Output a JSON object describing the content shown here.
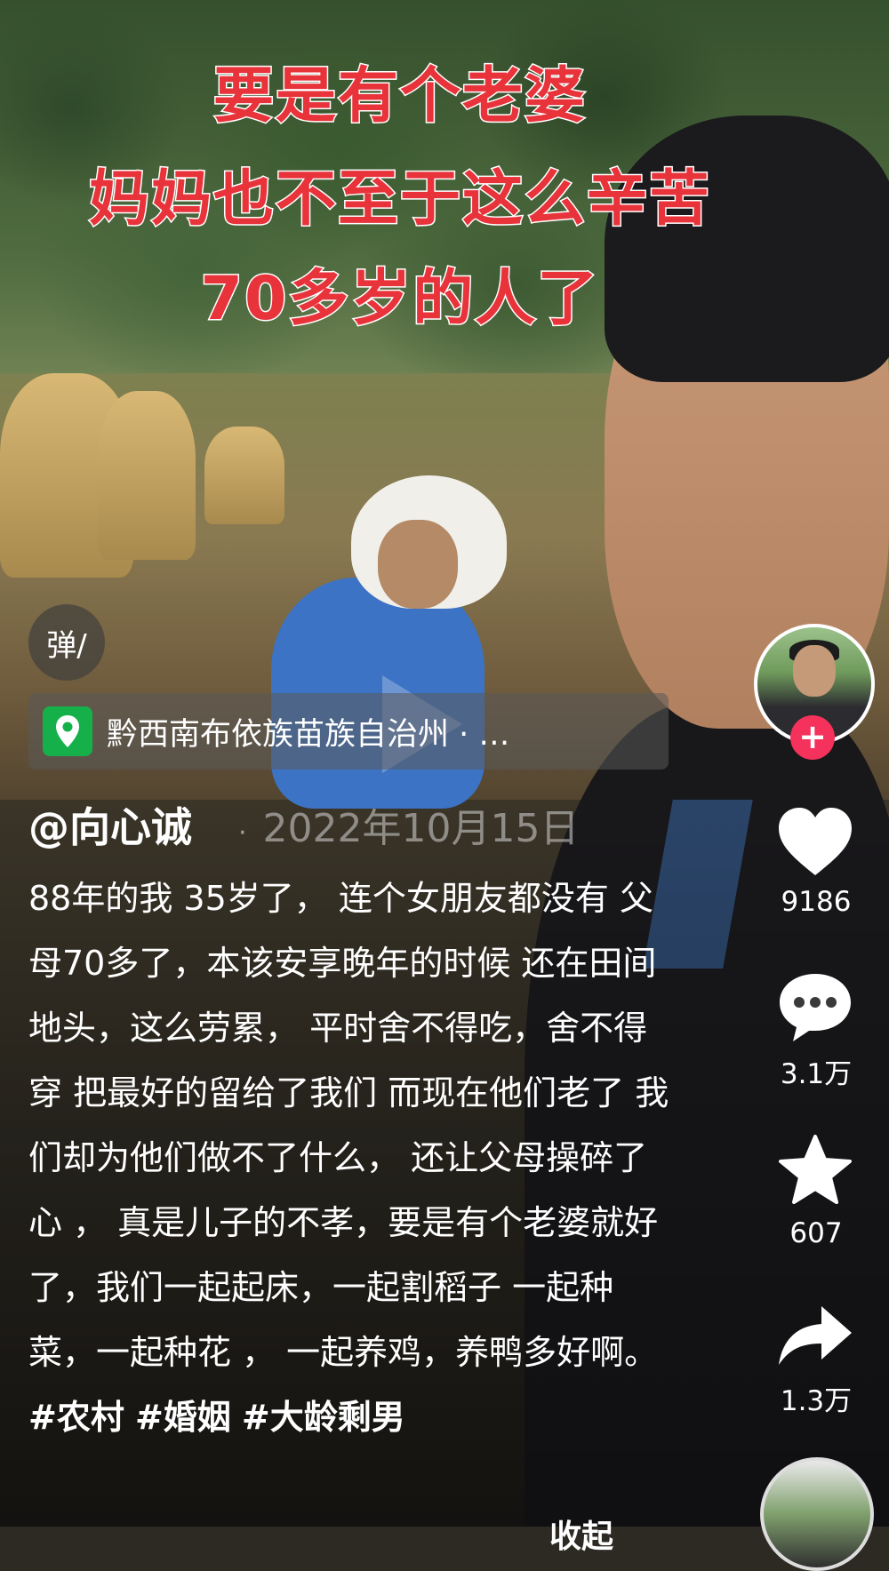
{
  "overlay_caption": {
    "line1": "要是有个老婆",
    "line2": "妈妈也不至于这么辛苦",
    "line3": "70多岁的人了"
  },
  "danmu_button": {
    "label": "弹/",
    "icon": "danmaku-icon"
  },
  "location": {
    "icon": "location-pin-icon",
    "text": "黔西南布依族苗族自治州 · …"
  },
  "author": {
    "handle": "@向心诚",
    "separator": "·",
    "date": "2022年10月15日"
  },
  "description": {
    "text": "88年的我 35岁了， 连个女朋友都没有 父母70多了，本该安享晚年的时候 还在田间地头，这么劳累， 平时舍不得吃，舍不得穿 把最好的留给了我们 而现在他们老了 我们却为他们做不了什么， 还让父母操碎了心 ， 真是儿子的不孝，要是有个老婆就好了，我们一起起床，一起割稻子 一起种菜，一起种花 ， 一起养鸡，养鸭多好啊。",
    "tags": [
      "#农村",
      "#婚姻",
      "#大龄剩男"
    ],
    "collapse_label": "收起"
  },
  "sidebar": {
    "follow_label": "+",
    "like": {
      "icon": "heart-icon",
      "count": "9186"
    },
    "comment": {
      "icon": "comment-icon",
      "count": "3.1万"
    },
    "favorite": {
      "icon": "star-icon",
      "count": "607"
    },
    "share": {
      "icon": "share-arrow-icon",
      "count": "1.3万"
    }
  },
  "colors": {
    "caption_red": "#e8333b",
    "follow_pink": "#f5325b",
    "location_green": "#16b04a"
  }
}
